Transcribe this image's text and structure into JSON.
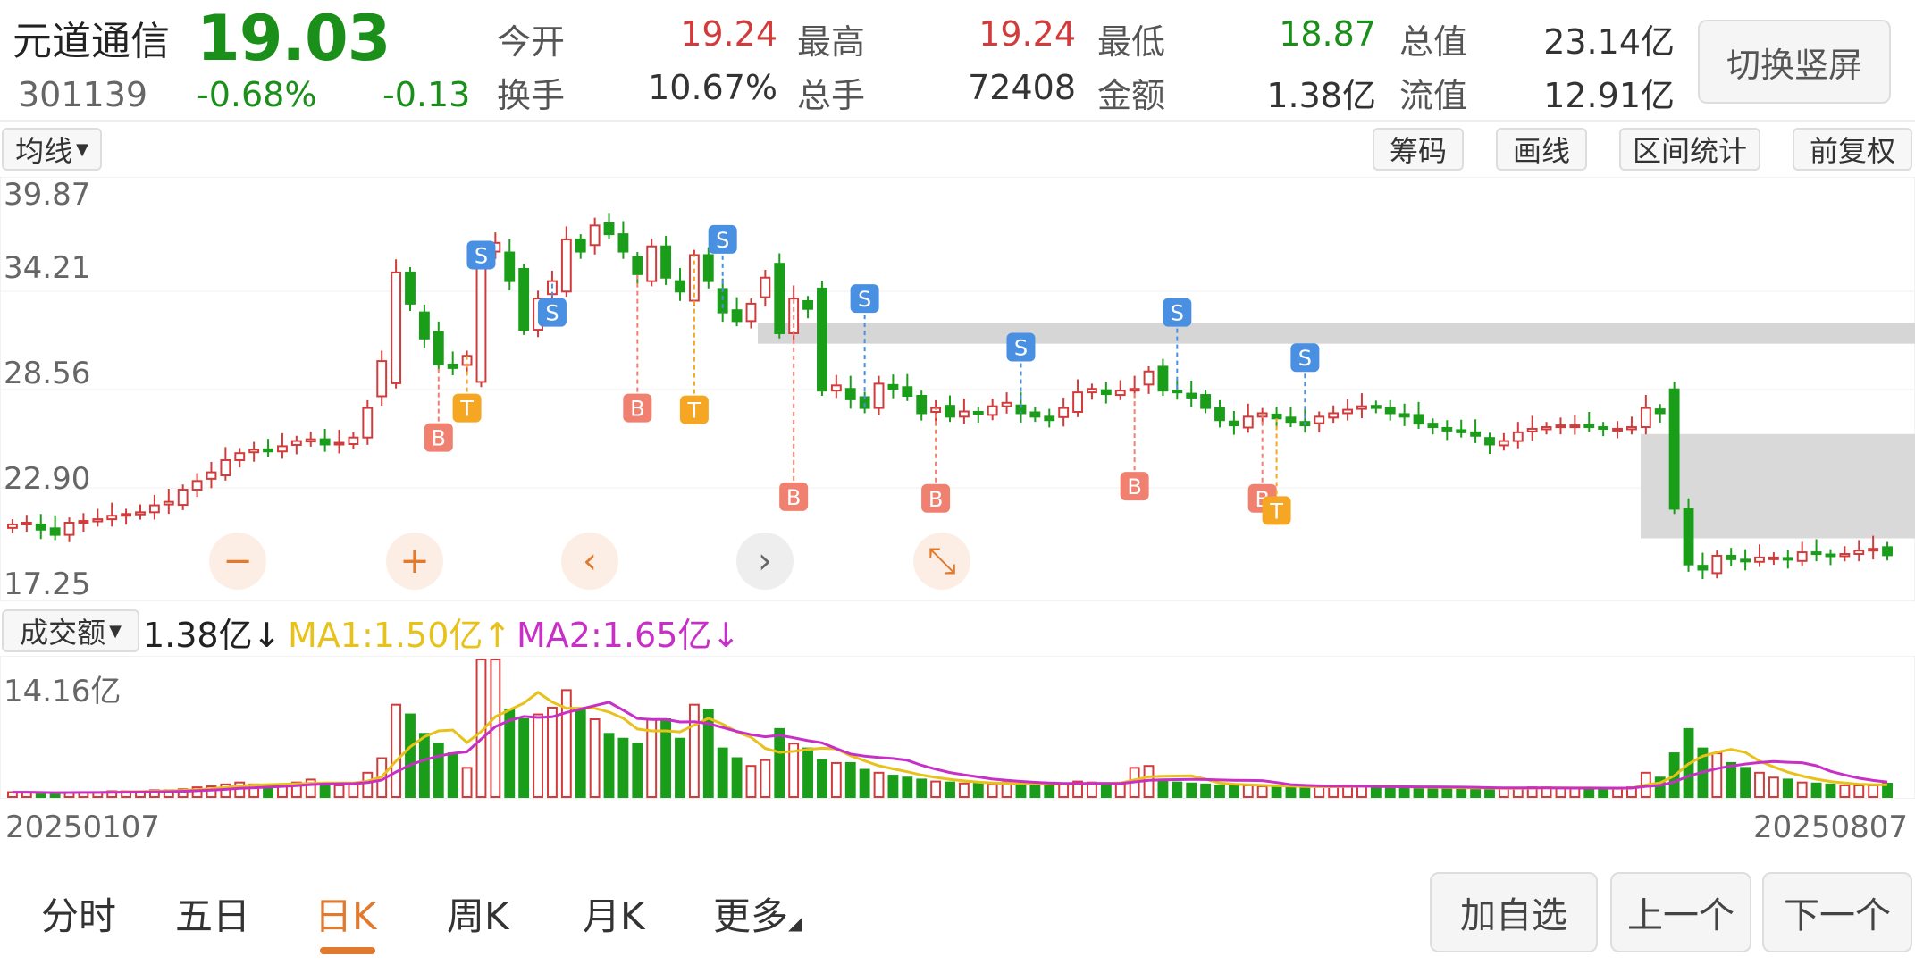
{
  "header": {
    "name": "元道通信",
    "price": "19.03",
    "code": "301139",
    "pct": "-0.68%",
    "change": "-0.13",
    "quotes": [
      {
        "label": "今开",
        "value": "19.24",
        "color": "red"
      },
      {
        "label": "最高",
        "value": "19.24",
        "color": "red"
      },
      {
        "label": "最低",
        "value": "18.87",
        "color": "green"
      },
      {
        "label": "总值",
        "value": "23.14亿",
        "color": "black"
      },
      {
        "label": "换手",
        "value": "10.67%",
        "color": "black"
      },
      {
        "label": "总手",
        "value": "72408",
        "color": "black"
      },
      {
        "label": "金额",
        "value": "1.38亿",
        "color": "black"
      },
      {
        "label": "流值",
        "value": "12.91亿",
        "color": "black"
      }
    ],
    "switch_label": "切换竖屏"
  },
  "toolbar": {
    "ma_label": "均线",
    "chips_label": "筹码",
    "draw_label": "画线",
    "range_label": "区间统计",
    "adjust_label": "前复权"
  },
  "price_axis": [
    "39.87",
    "34.21",
    "28.56",
    "22.90",
    "17.25"
  ],
  "volume": {
    "select_label": "成交额",
    "current": "1.38亿↓",
    "ma1": "MA1:1.50亿↑",
    "ma2": "MA2:1.65亿↓",
    "max_label": "14.16亿",
    "start_date": "20250107",
    "end_date": "20250807"
  },
  "colors": {
    "up": "#d23b3b",
    "down": "#1a9e1a",
    "accent": "#e07a2f",
    "ma1": "#e8c21a",
    "ma2": "#c72fc7",
    "buy": "#f08070",
    "sell": "#4a90e2",
    "t": "#f5a623"
  },
  "controls": [
    {
      "name": "zoom-out",
      "symbol": "−"
    },
    {
      "name": "zoom-in",
      "symbol": "+"
    },
    {
      "name": "move-left",
      "symbol": "‹"
    },
    {
      "name": "move-right",
      "symbol": "›"
    },
    {
      "name": "reset-zoom",
      "symbol": "⤡"
    }
  ],
  "tabs": [
    "分时",
    "五日",
    "日K",
    "周K",
    "月K",
    "更多"
  ],
  "active_tab": "日K",
  "bottom_buttons": {
    "add_watch": "加自选",
    "prev": "上一个",
    "next": "下一个"
  },
  "markers": {
    "buy": "B",
    "sell": "S",
    "t": "T"
  },
  "chart_data": {
    "type": "candlestick",
    "title": "",
    "x_range": [
      "20250107",
      "20250807"
    ],
    "y_range": [
      17.25,
      39.87
    ],
    "closes": [
      20.8,
      20.9,
      20.5,
      20.2,
      20.9,
      21.0,
      21.1,
      21.3,
      21.4,
      21.5,
      21.9,
      22.1,
      22.8,
      23.3,
      23.8,
      24.5,
      24.9,
      25.1,
      25.0,
      25.3,
      25.6,
      25.7,
      25.4,
      25.5,
      25.8,
      27.5,
      30.2,
      35.3,
      33.5,
      31.5,
      30.0,
      29.8,
      30.5,
      36.5,
      37.0,
      34.8,
      32.0,
      33.8,
      34.8,
      37.2,
      36.5,
      38.0,
      37.5,
      36.5,
      35.2,
      36.8,
      35.0,
      34.2,
      36.3,
      34.8,
      33.0,
      32.5,
      33.5,
      35.0,
      31.8,
      33.8,
      33.2,
      28.5,
      28.8,
      28.0,
      27.5,
      28.9,
      28.6,
      28.2,
      27.2,
      27.5,
      27.0,
      27.3,
      27.2,
      27.6,
      27.8,
      27.2,
      27.0,
      26.8,
      27.5,
      28.4,
      28.6,
      28.3,
      28.5,
      28.6,
      29.6,
      28.5,
      28.4,
      28.1,
      27.5,
      26.8,
      26.5,
      27.0,
      27.2,
      26.9,
      26.7,
      26.5,
      27.0,
      27.2,
      27.4,
      27.6,
      27.5,
      27.2,
      27.0,
      26.6,
      26.4,
      26.2,
      26.1,
      25.9,
      25.4,
      25.6,
      26.1,
      26.3,
      26.4,
      26.5,
      26.5,
      26.4,
      26.3,
      26.3,
      26.4,
      27.5,
      27.2,
      21.7,
      18.5,
      18.2,
      19.0,
      18.8,
      18.7,
      18.9,
      18.9,
      18.8,
      19.2,
      19.1,
      19.0,
      19.1,
      19.3,
      19.4,
      19.03
    ],
    "volumes": [
      0.5,
      0.5,
      0.4,
      0.4,
      0.5,
      0.5,
      0.5,
      0.6,
      0.6,
      0.6,
      0.7,
      0.7,
      0.8,
      1.0,
      1.1,
      1.3,
      1.5,
      1.3,
      1.2,
      1.3,
      1.5,
      1.8,
      1.4,
      1.2,
      1.3,
      2.5,
      4.0,
      9.5,
      8.5,
      6.5,
      5.5,
      4.5,
      3.0,
      14.16,
      14.16,
      9.0,
      8.0,
      8.5,
      9.2,
      11.0,
      9.0,
      8.0,
      6.5,
      6.0,
      5.5,
      8.0,
      8.0,
      6.0,
      9.5,
      9.0,
      5.0,
      4.0,
      3.2,
      3.8,
      7.0,
      5.5,
      5.0,
      3.8,
      3.5,
      3.5,
      2.8,
      2.5,
      2.2,
      2.0,
      1.8,
      1.6,
      1.5,
      1.4,
      1.4,
      1.3,
      1.5,
      1.4,
      1.3,
      1.2,
      1.4,
      1.6,
      1.5,
      1.4,
      1.3,
      3.0,
      3.2,
      1.8,
      1.5,
      1.4,
      1.3,
      1.2,
      1.2,
      1.2,
      1.1,
      1.1,
      1.0,
      1.0,
      1.1,
      1.1,
      1.2,
      1.1,
      1.0,
      1.0,
      1.0,
      1.0,
      1.0,
      0.9,
      0.9,
      0.9,
      0.9,
      0.9,
      0.9,
      1.0,
      1.0,
      0.9,
      0.9,
      0.9,
      0.9,
      0.9,
      1.0,
      2.5,
      2.0,
      4.5,
      7.0,
      5.0,
      4.5,
      3.5,
      3.0,
      2.5,
      2.0,
      1.8,
      1.5,
      1.4,
      1.3,
      1.2,
      1.2,
      1.2,
      1.38
    ],
    "volume_max": 14.16
  }
}
